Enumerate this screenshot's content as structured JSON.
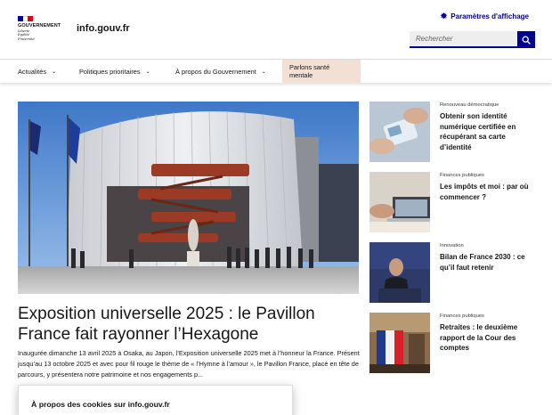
{
  "colors": {
    "primary": "#000091",
    "flag_blue": "#000091",
    "flag_white": "#ffffff",
    "flag_red": "#e1000f",
    "nav_highlight": "#f4dfd4"
  },
  "header": {
    "logo_word": "GOUVERNEMENT",
    "motto": [
      "Liberté",
      "Égalité",
      "Fraternité"
    ],
    "site_name": "info.gouv.fr",
    "display_settings": "Paramètres d'affichage",
    "display_icon": "sun-icon",
    "search_placeholder": "Rechercher",
    "search_icon": "search-icon"
  },
  "nav": {
    "items": [
      {
        "label": "Actualités"
      },
      {
        "label": "Politiques prioritaires"
      },
      {
        "label": "À propos du Gouvernement"
      },
      {
        "label": "Parlons santé mentale"
      }
    ]
  },
  "hero": {
    "title": "Exposition universelle 2025 : le Pavillon France fait rayonner l’Hexagone",
    "description": "Inaugurée dimanche 13 avril 2025 à Osaka, au Japon, l’Exposition universelle 2025 met à l’honneur la France. Présent jusqu’au 13 octobre 2025 et avec pour fil rouge le thème de « l’Hymne à l’amour », le Pavillon France, placé en tête de parcours, y présentera notre patrimoine et nos engagements p..."
  },
  "news": [
    {
      "category": "Renouveau démocratique",
      "title": "Obtenir son identité numérique certifiée en récupérant sa carte d’identité"
    },
    {
      "category": "Finances publiques",
      "title": "Les impôts et moi : par où commencer ?"
    },
    {
      "category": "Innovation",
      "title": "Bilan de France 2030 : ce qu’il faut retenir"
    },
    {
      "category": "Finances publiques",
      "title": "Retraites : le deuxième rapport de la Cour des comptes"
    }
  ],
  "cookie": {
    "title": "À propos des cookies sur info.gouv.fr"
  }
}
